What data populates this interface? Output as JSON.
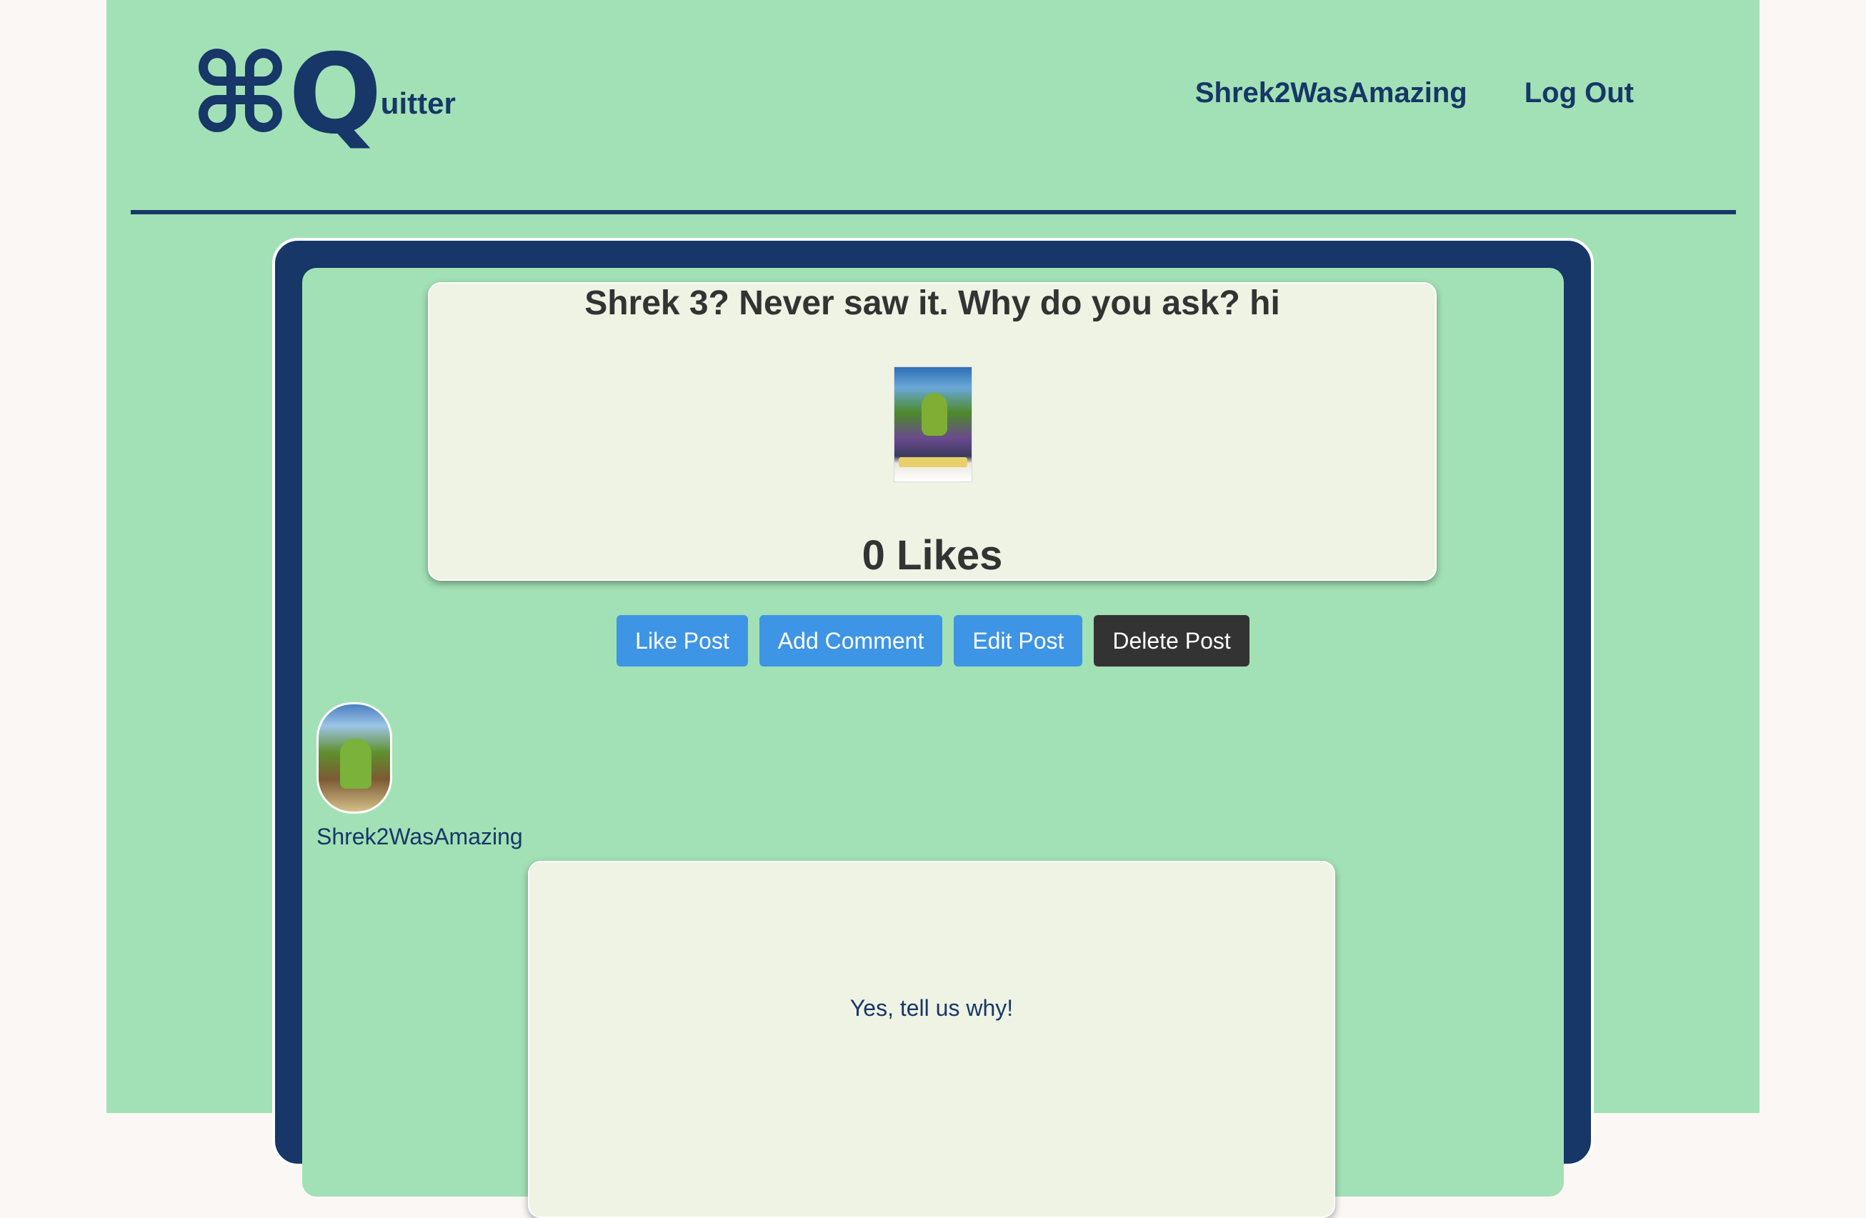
{
  "header": {
    "logo_mark": "⌘Q",
    "logo_text": "uitter",
    "nav": {
      "username": "Shrek2WasAmazing",
      "logout": "Log Out"
    }
  },
  "post": {
    "title": "Shrek 3? Never saw it. Why do you ask? hi",
    "image_alt": "Shrek the Third poster",
    "likes": "0 Likes",
    "actions": {
      "like": "Like Post",
      "add_comment": "Add Comment",
      "edit": "Edit Post",
      "delete": "Delete Post"
    }
  },
  "comments": [
    {
      "username": "Shrek2WasAmazing",
      "text": "Yes, tell us why!"
    }
  ],
  "colors": {
    "background": "#a2e1b5",
    "primary_dark": "#163768",
    "card": "#eff3e4",
    "button_blue": "#3e95e6",
    "button_dark": "#333333"
  }
}
